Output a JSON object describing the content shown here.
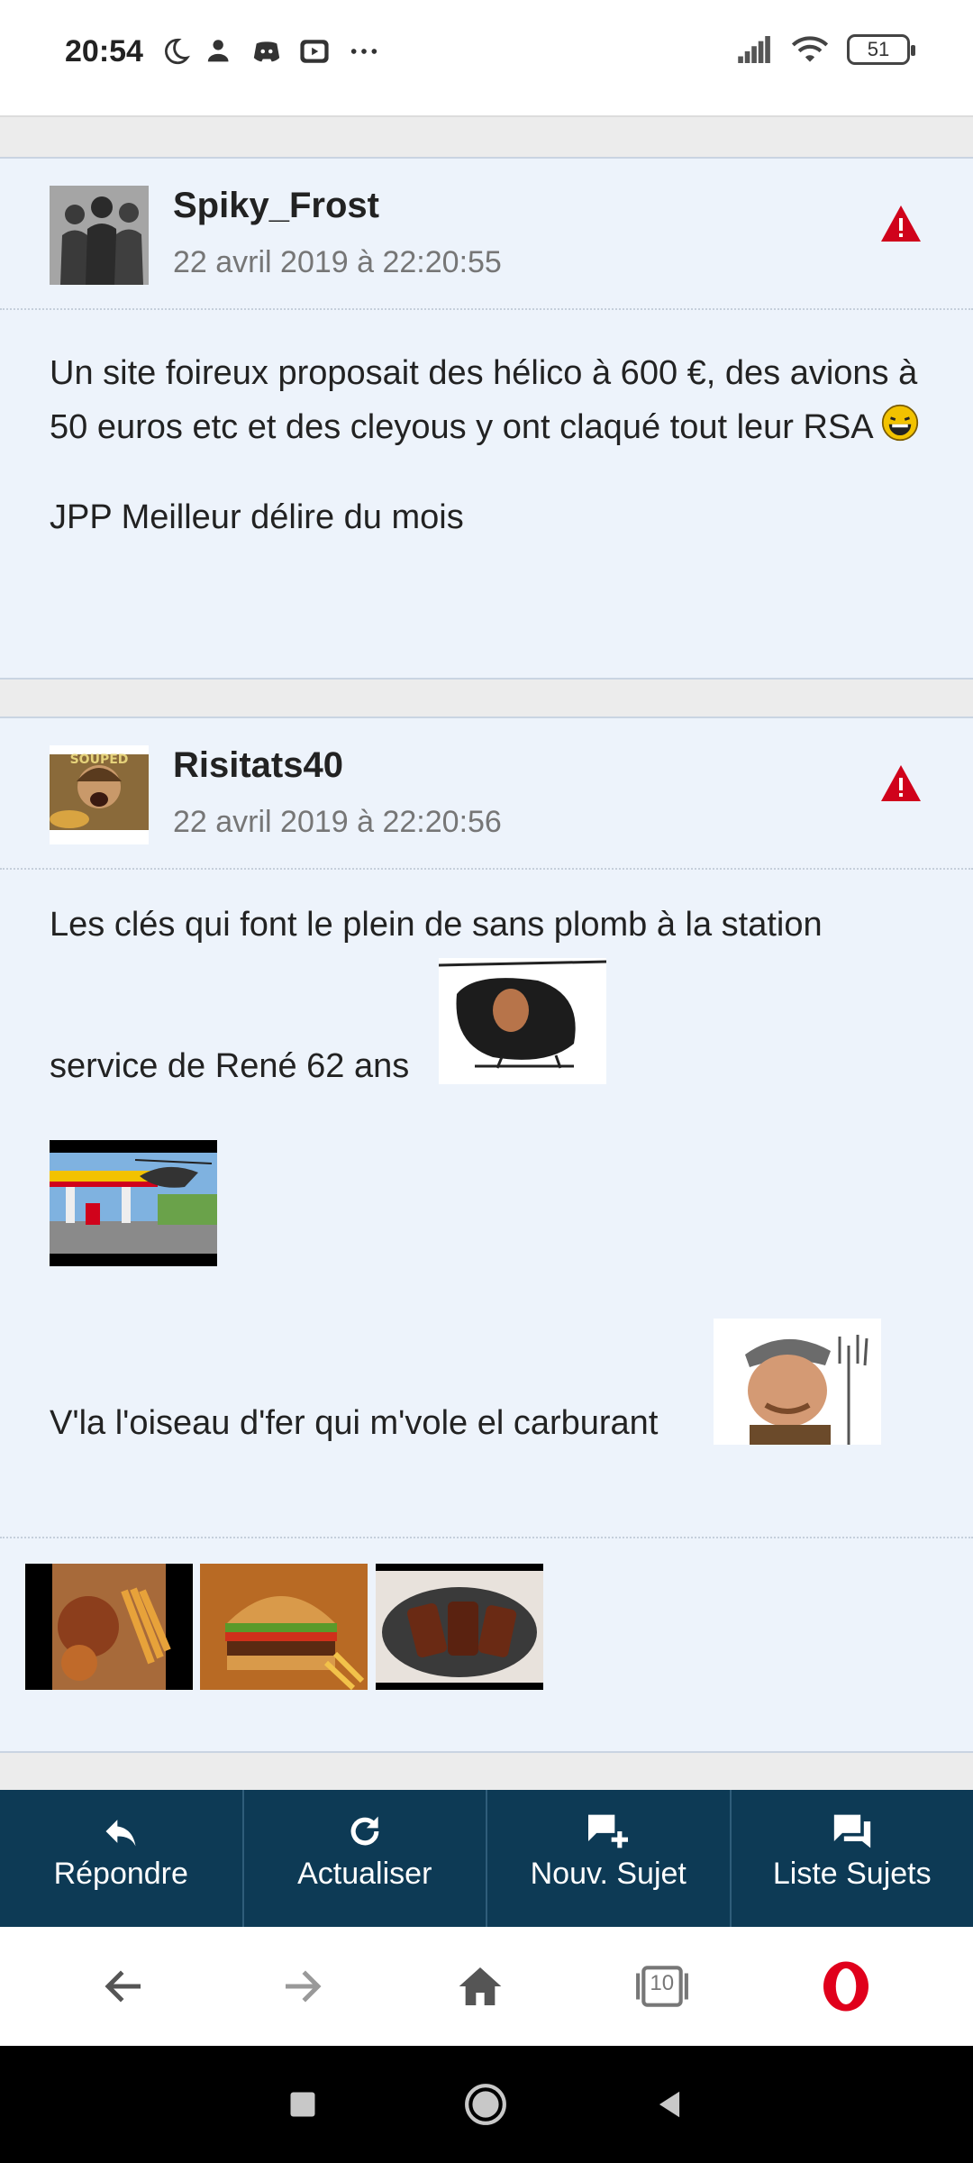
{
  "status": {
    "time": "20:54",
    "battery": "51"
  },
  "posts": [
    {
      "author": "Spiky_Frost",
      "date": "22 avril 2019 à 22:20:55",
      "paragraphs": [
        "Un site foireux proposait des hélico à 600 €, des avions à 50 euros etc et des cleyous y ont claqué tout leur RSA",
        "JPP Meilleur délire du mois"
      ]
    },
    {
      "author": "Risitats40",
      "date": "22 avril 2019 à 22:20:56",
      "lines": [
        "Les clés qui font le plein de sans plomb à la station",
        "service de René 62 ans",
        "V'la l'oiseau d'fer qui m'vole el carburant"
      ],
      "avatar_text": "SOUPED"
    }
  ],
  "actions": [
    {
      "label": "Répondre",
      "icon": "reply-icon"
    },
    {
      "label": "Actualiser",
      "icon": "refresh-icon"
    },
    {
      "label": "Nouv. Sujet",
      "icon": "new-topic-icon"
    },
    {
      "label": "Liste Sujets",
      "icon": "topic-list-icon"
    }
  ],
  "browser": {
    "tabs_count": "10"
  },
  "colors": {
    "post_bg": "#edf3fb",
    "action_bar": "#0d3a55",
    "warning": "#d0021b"
  }
}
